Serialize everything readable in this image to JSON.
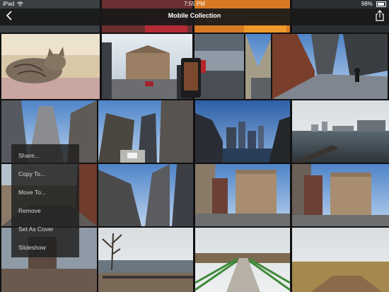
{
  "status_bar": {
    "carrier": "iPad",
    "time": "7:55 PM",
    "battery": "98%",
    "icons": [
      "wifi-icon",
      "battery-icon"
    ]
  },
  "nav": {
    "title": "Mobile Collection",
    "icons": [
      "back-chevron-icon",
      "share-icon"
    ]
  },
  "context_menu": {
    "items": [
      {
        "label": "Share..."
      },
      {
        "label": "Copy To..."
      },
      {
        "label": "Move To..."
      },
      {
        "label": "Remove"
      },
      {
        "label": "Set As Cover"
      },
      {
        "label": "Slideshow"
      }
    ]
  },
  "grid": {
    "photos": [
      {
        "subject": "photo-top-strip-1"
      },
      {
        "subject": "photo-top-strip-2"
      },
      {
        "subject": "photo-top-strip-3"
      },
      {
        "subject": "photo-top-strip-4"
      },
      {
        "subject": "photo-cat"
      },
      {
        "subject": "photo-plaza-building"
      },
      {
        "subject": "photo-street-cafe"
      },
      {
        "subject": "photo-skyscrapers-low-angle"
      },
      {
        "subject": "photo-tower-walkway"
      },
      {
        "subject": "photo-glass-towers-up"
      },
      {
        "subject": "photo-office-towers"
      },
      {
        "subject": "photo-corner-building"
      },
      {
        "subject": "photo-city-skyline-harbor"
      },
      {
        "subject": "photo-waterfront-skyline"
      },
      {
        "subject": "photo-brick-street"
      },
      {
        "subject": "photo-glass-towers-up-2"
      },
      {
        "subject": "photo-street-buildings"
      },
      {
        "subject": "photo-corner-building-2"
      },
      {
        "subject": "photo-building-street-2"
      },
      {
        "subject": "photo-bare-tree-waterfront"
      },
      {
        "subject": "photo-green-bridge"
      },
      {
        "subject": "photo-boardwalk-marsh"
      }
    ]
  }
}
